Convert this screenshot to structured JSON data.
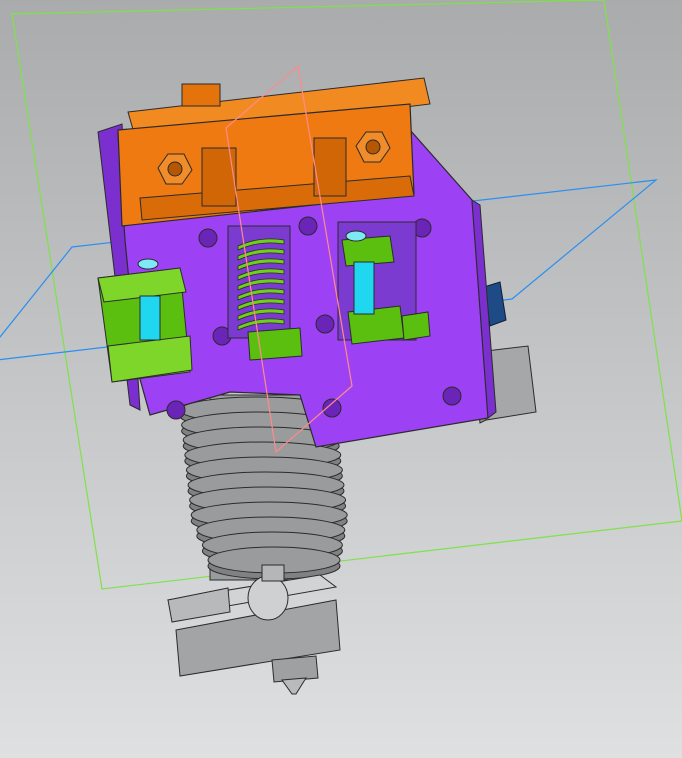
{
  "viewport": {
    "background_top": "#a9abad",
    "background_bottom": "#dfe0e1"
  },
  "model": {
    "colors": {
      "fan_duct": "#ef7a11",
      "carriage_plate": "#9c42f4",
      "bearing_block": "#5bbf10",
      "rod": "#1fd8f0",
      "spring": "#6fcf1a",
      "heatsink": "#9a9b9d",
      "heater_block": "#a3a4a6",
      "side_block": "#a6a7a9",
      "connector": "#1e4a86",
      "datum_plane_green": "#7fe24a",
      "datum_plane_blue": "#2a8ff0",
      "datum_plane_red": "#ff8a8a"
    },
    "parts": [
      {
        "id": "datum-plane-green",
        "kind": "reference-plane"
      },
      {
        "id": "datum-plane-blue",
        "kind": "reference-plane"
      },
      {
        "id": "datum-plane-red",
        "kind": "reference-plane"
      },
      {
        "id": "fan-duct",
        "kind": "solid"
      },
      {
        "id": "carriage-plate",
        "kind": "solid"
      },
      {
        "id": "bearing-block-left",
        "kind": "solid"
      },
      {
        "id": "bearing-block-center",
        "kind": "solid"
      },
      {
        "id": "bearing-block-right",
        "kind": "solid"
      },
      {
        "id": "compression-spring",
        "kind": "solid"
      },
      {
        "id": "heatsink-fins",
        "kind": "solid"
      },
      {
        "id": "heater-block",
        "kind": "solid"
      },
      {
        "id": "nozzle",
        "kind": "solid"
      },
      {
        "id": "side-block",
        "kind": "solid"
      },
      {
        "id": "wire-connector",
        "kind": "solid"
      }
    ]
  }
}
